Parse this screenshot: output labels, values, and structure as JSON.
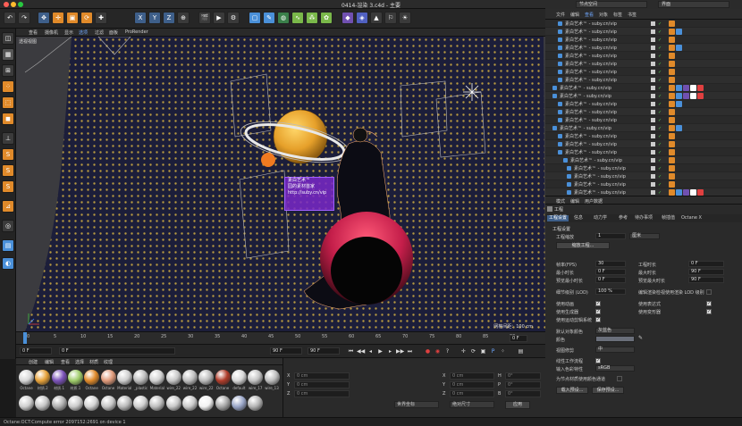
{
  "window": {
    "title": "0414-渲染 3.c4d - 主要",
    "traffic_colors": [
      "#fe5f57",
      "#febc2e",
      "#28c840"
    ]
  },
  "layout": {
    "node_space": "节点空间",
    "layout_name": "界面"
  },
  "toolbar": {
    "axis_x": "X",
    "axis_y": "Y",
    "axis_z": "Z"
  },
  "viewport": {
    "menu": [
      "查看",
      "摄像机",
      "显示",
      "选项",
      "过滤",
      "面板",
      "ProRender"
    ],
    "label": "透视视图",
    "grid_spacing": "网格间距：100 cm",
    "tag_lines": [
      "素白艺术™",
      "园的素材首家",
      "http://suby.cn/vip"
    ],
    "accent": "#3e5f8a"
  },
  "timeline": {
    "ticks": [
      "0",
      "5",
      "10",
      "15",
      "20",
      "25",
      "30",
      "35",
      "40",
      "45",
      "50",
      "55",
      "60",
      "65",
      "70",
      "75",
      "80",
      "85",
      "90"
    ],
    "frame_end": "0 F"
  },
  "transport": {
    "start": "0 F",
    "current": "0 F",
    "end": "90 F",
    "end2": "90 F"
  },
  "materials": {
    "menu": [
      "创建",
      "编辑",
      "查看",
      "选择",
      "材质",
      "纹理"
    ],
    "row1": [
      {
        "label": "Octane",
        "color": "#d8d8d8"
      },
      {
        "label": "材质.2",
        "color": "#e7a23a"
      },
      {
        "label": "材质.1",
        "color": "#7a52b8"
      },
      {
        "label": "材质.1",
        "color": "#9fcc6a"
      },
      {
        "label": "Octane",
        "color": "#e08a2a"
      },
      {
        "label": "Octane",
        "color": "#e09a7a"
      },
      {
        "label": "Material",
        "color": "#cfcfcf"
      },
      {
        "label": "_plastic",
        "color": "#bdbdbd"
      },
      {
        "label": "Material",
        "color": "#d2d2d2"
      },
      {
        "label": "wire_22",
        "color": "#c8c8c8"
      },
      {
        "label": "wire_22",
        "color": "#c0c0c0"
      },
      {
        "label": "wire_22",
        "color": "#bcbcbc"
      },
      {
        "label": "Octane",
        "color": "#b03c2a"
      },
      {
        "label": "default",
        "color": "#d8d8d8"
      },
      {
        "label": "wire_17",
        "color": "#c4c4c4"
      },
      {
        "label": "wire_13",
        "color": "#bdbdbd"
      }
    ],
    "row2_colors": [
      "#d0d0d0",
      "#c5c5c5",
      "#b0b0b0",
      "#cccccc",
      "#d4d4d4",
      "#c7c7c7",
      "#bbbbbb",
      "#d0d0d0",
      "#c0c0c0",
      "#c9c9c9",
      "#cbcbcb",
      "#f2f2f2",
      "#a8a8a8",
      "#9aa6c8",
      "#b5b5b5"
    ]
  },
  "coords": {
    "x": "X",
    "y": "Y",
    "z": "Z",
    "h": "H",
    "p": "P",
    "b": "B",
    "zero": "0 cm",
    "zero_deg": "0°",
    "mode1": "世界坐标",
    "mode2": "绝对尺寸",
    "apply": "应用"
  },
  "status": {
    "text": "Octane:OCT:Compute error 2097152:2691 on device 1"
  },
  "objects": {
    "menu": [
      "文件",
      "编辑",
      "查看",
      "对象",
      "标签",
      "书签"
    ],
    "rows": [
      "素白艺术™ - suby.cn/vip",
      "素白艺术™ - suby.cn/vip",
      "素白艺术™ - suby.cn/vip",
      "素白艺术™ - suby.cn/vip",
      "素白艺术™ - suby.cn/vip",
      "素白艺术™ - suby.cn/vip",
      "素白艺术™ - suby.cn/vip",
      "素白艺术™ - suby.cn/vip",
      "素白艺术™ - suby.cn/vip",
      "素白艺术™ - suby.cn/vip",
      "素白艺术™ - suby.cn/vip",
      "素白艺术™ - suby.cn/vip",
      "素白艺术™ - suby.cn/vip",
      "素白艺术™ - suby.cn/vip",
      "素白艺术™ - suby.cn/vip",
      "素白艺术™ - suby.cn/vip",
      "素白艺术™ - suby.cn/vip",
      "素白艺术™ - suby.cn/vip",
      "素白艺术™ - suby.cn/vip",
      "素白艺术™ - suby.cn/vip",
      "素白艺术™ - suby.cn/vip",
      "素白艺术™ - suby.cn/vip"
    ]
  },
  "attributes": {
    "menu": [
      "模式",
      "编辑",
      "用户数据"
    ],
    "title": "工程",
    "tabs": [
      "工程设置",
      "信息",
      "动力学",
      "参考",
      "待办事项",
      "帧插值",
      "Octane X"
    ],
    "section": "工程设置",
    "scale_label": "工程缩放",
    "scale_value": "1",
    "scale_unit": "厘米",
    "scale_btn": "缩放工程...",
    "fps_label": "帧率(FPS)",
    "fps_value": "30",
    "proj_time_label": "工程时长",
    "proj_time_value": "0 F",
    "min_time_label": "最小时长",
    "min_time_value": "0 F",
    "max_time_label": "最大时长",
    "max_time_value": "90 F",
    "prev_min_label": "预览最小时长",
    "prev_min_value": "0 F",
    "prev_max_label": "预览最大时长",
    "prev_max_value": "90 F",
    "lod_label": "细节级别 (LOD)",
    "lod_value": "100 %",
    "lod_check_label": "编辑渲染检视使用渲染 LOD 级别",
    "use_anim": "使用动画",
    "use_expr": "使用表达式",
    "use_gen": "使用生成器",
    "use_deform": "使用变形器",
    "use_motion": "使用运动剪辑系统",
    "default_color_label": "默认对象颜色",
    "default_color_value": "灰蓝色",
    "color_label": "颜色",
    "view_clip_label": "视图修剪",
    "view_clip_value": "中",
    "linear_label": "线性工作流程",
    "input_color_label": "输入色彩特性",
    "input_color_value": "sRGB",
    "node_mat_label": "为节点材质使用颜色通道",
    "load_btn": "载入预设...",
    "save_btn": "保存预设..."
  }
}
